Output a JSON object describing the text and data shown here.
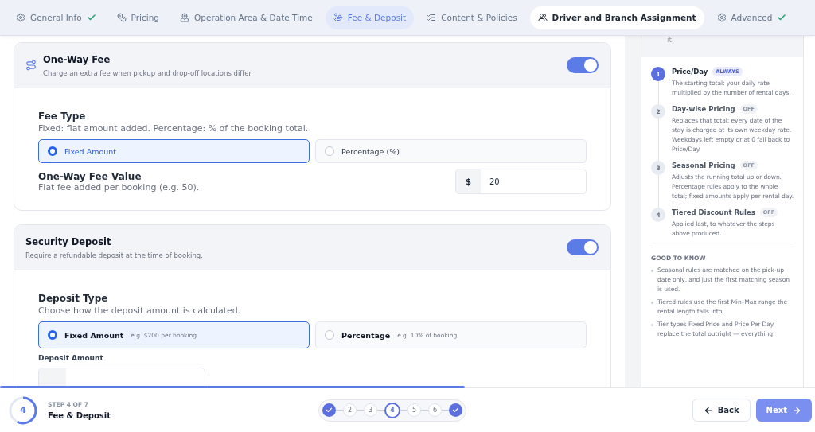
{
  "tabs": [
    {
      "label": "General Info",
      "selected": false,
      "completed": true,
      "hovered": false
    },
    {
      "label": "Pricing",
      "selected": false,
      "completed": false,
      "hovered": false
    },
    {
      "label": "Operation Area & Date Time",
      "selected": false,
      "completed": false,
      "hovered": false
    },
    {
      "label": "Fee & Deposit",
      "selected": true,
      "completed": false,
      "hovered": false
    },
    {
      "label": "Content & Policies",
      "selected": false,
      "completed": false,
      "hovered": false
    },
    {
      "label": "Driver and Branch Assignment",
      "selected": false,
      "completed": false,
      "hovered": true
    },
    {
      "label": "Advanced",
      "selected": false,
      "completed": true,
      "hovered": false
    }
  ],
  "one_way_fee": {
    "title": "One-Way Fee",
    "description": "Charge an extra fee when pickup and drop-off locations differ.",
    "on": true,
    "fee_type": {
      "label": "Fee Type",
      "help": "Fixed: flat amount added. Percentage: % of the booking total.",
      "options": [
        {
          "label": "Fixed Amount",
          "selected": true
        },
        {
          "label": "Percentage (%)",
          "selected": false
        }
      ]
    },
    "fee_value": {
      "label": "One-Way Fee Value",
      "help": "Flat fee added per booking (e.g. 50).",
      "prefix": "$",
      "value": "20"
    }
  },
  "security_deposit": {
    "title": "Security Deposit",
    "description": "Require a refundable deposit at the time of booking.",
    "on": true,
    "deposit_type": {
      "label": "Deposit Type",
      "help": "Choose how the deposit amount is calculated.",
      "options": [
        {
          "label": "Fixed Amount",
          "hint": "e.g. $200 per booking",
          "selected": true
        },
        {
          "label": "Percentage",
          "hint": "e.g. 10% of booking",
          "selected": false
        }
      ]
    },
    "deposit_amount": {
      "label": "Deposit Amount"
    }
  },
  "sidebar": {
    "cut_text": "it.",
    "steps": [
      {
        "number": "1",
        "title": "Price/Day",
        "badge": "ALWAYS",
        "active": true,
        "description": "The starting total: your daily rate multiplied by the number of rental days."
      },
      {
        "number": "2",
        "title": "Day-wise Pricing",
        "badge": "OFF",
        "active": false,
        "description": "Replaces that total: every date of the stay is charged at its own weekday rate. Weekdays left empty or at 0 fall back to Price/Day."
      },
      {
        "number": "3",
        "title": "Seasonal Pricing",
        "badge": "OFF",
        "active": false,
        "description": "Adjusts the running total up or down. Percentage rules apply to the whole total; fixed amounts apply per rental day."
      },
      {
        "number": "4",
        "title": "Tiered Discount Rules",
        "badge": "OFF",
        "active": false,
        "description": "Applied last, to whatever the steps above produced."
      }
    ],
    "good_to_know": {
      "heading": "GOOD TO KNOW",
      "items": [
        "Seasonal rules are matched on the pick-up date only, and just the first matching season is used.",
        "Tiered rules use the first Min–Max range the rental length falls into.",
        "Tier types Fixed Price and Price Per Day replace the total outright — everything"
      ]
    }
  },
  "footer": {
    "progress": {
      "level": 0.57
    },
    "ring": {
      "label": "4"
    },
    "step_caption": "STEP 4 OF 7",
    "step_title": "Fee & Deposit",
    "stepper": [
      {
        "done": true,
        "current": false
      },
      {
        "done": false,
        "current": false,
        "label": "2"
      },
      {
        "done": false,
        "current": false,
        "label": "3"
      },
      {
        "done": false,
        "current": true,
        "label": "4"
      },
      {
        "done": false,
        "current": false,
        "label": "5"
      },
      {
        "done": false,
        "current": false,
        "label": "6"
      },
      {
        "done": true,
        "current": false
      }
    ],
    "back": "Back",
    "next": "Next"
  }
}
